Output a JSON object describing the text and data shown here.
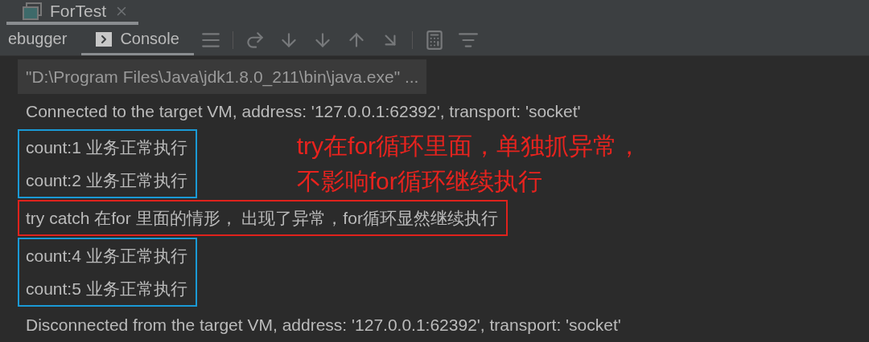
{
  "editor_tabs": [
    {
      "label": "ForTest",
      "selected": true
    }
  ],
  "tool_tabs": [
    {
      "label": "ebugger",
      "selected": false
    },
    {
      "label": "Console",
      "selected": true
    }
  ],
  "toolbar": [
    {
      "kind": "lines"
    },
    {
      "kind": "sep"
    },
    {
      "kind": "step-over"
    },
    {
      "kind": "down"
    },
    {
      "kind": "down"
    },
    {
      "kind": "up"
    },
    {
      "kind": "cursor"
    },
    {
      "kind": "sep"
    },
    {
      "kind": "calc"
    },
    {
      "kind": "list"
    }
  ],
  "console": [
    {
      "kind": "line",
      "text": "\"D:\\Program Files\\Java\\jdk1.8.0_211\\bin\\java.exe\" ...",
      "highlighted": true
    },
    {
      "kind": "line",
      "text": "Connected to the target VM, address: '127.0.0.1:62392', transport: 'socket'",
      "highlighted": false
    },
    {
      "kind": "box",
      "color": "#1a9ad6",
      "lines": [
        "count:1 业务正常执行",
        "count:2 业务正常执行"
      ],
      "note": [
        "try在for循环里面，单独抓异常，",
        "不影响for循环继续执行"
      ]
    },
    {
      "kind": "box",
      "color": "#e0221c",
      "lines": [
        "try catch  在for 里面的情形， 出现了异常，for循环显然继续执行"
      ]
    },
    {
      "kind": "box",
      "color": "#1a9ad6",
      "lines": [
        "count:4 业务正常执行",
        "count:5 业务正常执行"
      ]
    },
    {
      "kind": "line",
      "text": "Disconnected from the target VM, address: '127.0.0.1:62392', transport: 'socket'",
      "highlighted": false
    }
  ]
}
